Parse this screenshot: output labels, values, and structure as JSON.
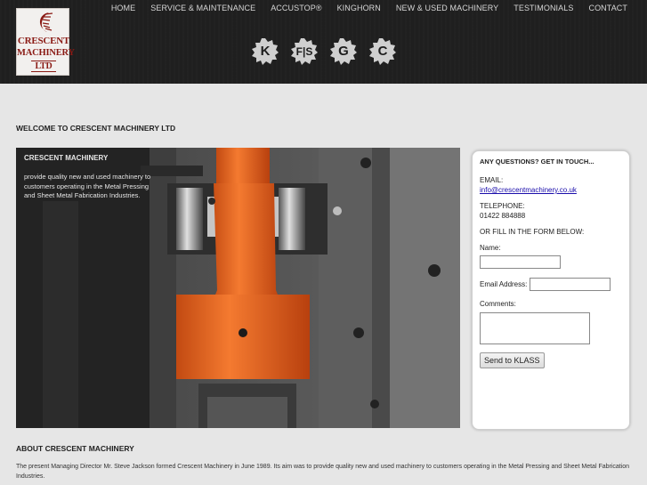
{
  "logo": {
    "line1": "CRESCENT",
    "line2": "MACHINERY",
    "line3": "LTD"
  },
  "nav": {
    "items": [
      "HOME",
      "SERVICE & MAINTENANCE",
      "ACCUSTOP®",
      "KINGHORN",
      "NEW & USED MACHINERY",
      "TESTIMONIALS",
      "CONTACT"
    ]
  },
  "brand_badges": {
    "items": [
      {
        "letter": "K",
        "icon": "kinghorn-logo"
      },
      {
        "letter": "F|S",
        "icon": "fs-logo"
      },
      {
        "letter": "G",
        "icon": "g-logo"
      },
      {
        "letter": "C",
        "icon": "crescent-logo"
      }
    ],
    "color": "#cfcfcf"
  },
  "welcome": {
    "heading": "WELCOME TO CRESCENT MACHINERY LTD"
  },
  "hero": {
    "title": "CRESCENT MACHINERY",
    "text": "provide quality new and used machinery to customers operating in the Metal Pressing and Sheet Metal Fabrication Industries.",
    "accent_color": "#f06a2a"
  },
  "contact": {
    "heading": "ANY QUESTIONS? GET IN TOUCH...",
    "email_label": "EMAIL:",
    "email_value": "info@crescentmachinery.co.uk",
    "telephone_label": "TELEPHONE:",
    "telephone_value": "01422 884888",
    "form_intro": "OR FILL IN THE FORM BELOW:",
    "name_label": "Name:",
    "name_value": "",
    "email_address_label": "Email Address:",
    "email_address_value": "",
    "comments_label": "Comments:",
    "comments_value": "",
    "send_label": "Send to KLASS"
  },
  "about": {
    "heading": "ABOUT CRESCENT MACHINERY",
    "text": "The present Managing Director Mr. Steve Jackson formed Crescent Machinery in June 1989. Its aim was to provide quality new and used machinery to customers operating in the Metal Pressing and Sheet Metal Fabrication Industries."
  }
}
